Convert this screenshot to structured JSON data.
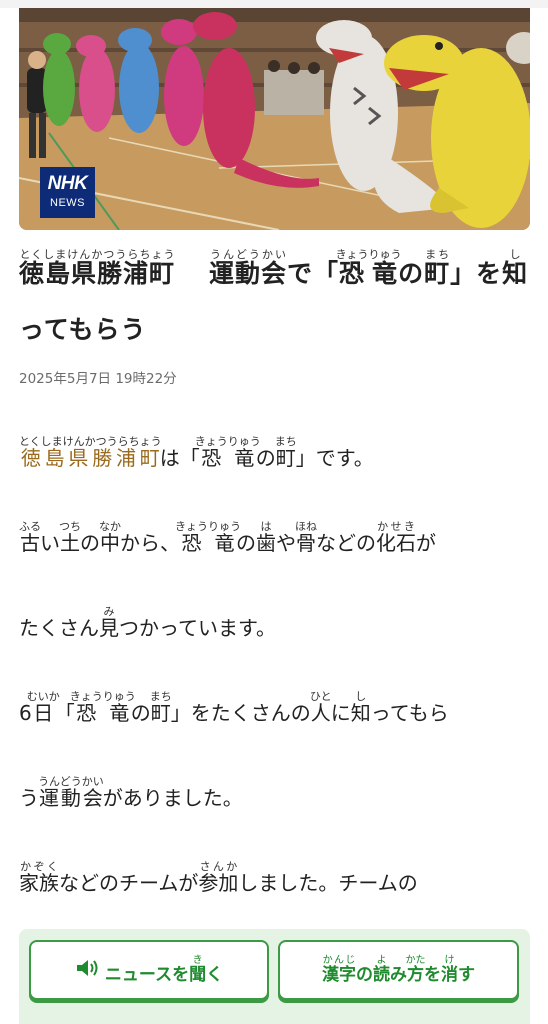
{
  "hero": {
    "badge_line1": "NHK",
    "badge_line2": "NEWS"
  },
  "article": {
    "title": {
      "part1": "徳島県勝浦町",
      "part1_ruby": "とくしまけんかつうらちょう",
      "part2": "運動会",
      "part2_ruby": "うんどうかい",
      "part3": "で「",
      "part4": "恐竜",
      "part4_ruby": "きょうりゅう",
      "part5": "の",
      "part6": "町",
      "part6_ruby": "まち",
      "part7": "」を",
      "part8": "知",
      "part8_ruby": "し",
      "part9": "ってもらう"
    },
    "date": "2025年5月7日 19時22分",
    "p1": {
      "place": "徳島県勝浦町",
      "place_ruby": "とくしまけんかつうらちょう",
      "t1": "は「",
      "k1": "恐竜",
      "k1_ruby": "きょうりゅう",
      "t2": "の",
      "k2": "町",
      "k2_ruby": "まち",
      "t3": "」です。"
    },
    "p2": {
      "k1": "古",
      "k1_ruby": "ふる",
      "t1": "い",
      "k2": "土",
      "k2_ruby": "つち",
      "t2": "の",
      "k3": "中",
      "k3_ruby": "なか",
      "t3": "から、",
      "k4": "恐竜",
      "k4_ruby": "きょうりゅう",
      "t4": "の",
      "k5": "歯",
      "k5_ruby": "は",
      "t5": "や",
      "k6": "骨",
      "k6_ruby": "ほね",
      "t6": "などの",
      "k7": "化石",
      "k7_ruby": "かせき",
      "t7": "が"
    },
    "p3": {
      "t1": "たくさん",
      "k1": "見",
      "k1_ruby": "み",
      "t2": "つかっています。"
    },
    "p4": {
      "t1": "6",
      "k1": "日",
      "k1_ruby": "むいか",
      "t2": "「",
      "k2": "恐竜",
      "k2_ruby": "きょうりゅう",
      "t3": "の",
      "k3": "町",
      "k3_ruby": "まち",
      "t4": "」をたくさんの",
      "k4": "人",
      "k4_ruby": "ひと",
      "t5": "に",
      "k5": "知",
      "k5_ruby": "し",
      "t6": "ってもら"
    },
    "p5": {
      "t1": "う",
      "k1": "運動会",
      "k1_ruby": "うんどうかい",
      "t2": "がありました。"
    },
    "p6": {
      "k1": "家族",
      "k1_ruby": "かぞく",
      "t1": "などのチームが",
      "k2": "参加",
      "k2_ruby": "さんか",
      "t2": "しました。チームの"
    }
  },
  "actions": {
    "listen_pre": "ニュースを",
    "listen_kanji": "聞",
    "listen_kanji_ruby": "き",
    "listen_post": "く",
    "kanji_k1": "漢字",
    "kanji_k1_ruby": "かんじ",
    "kanji_t1": "の",
    "kanji_k2": "読",
    "kanji_k2_ruby": "よ",
    "kanji_t2": "み",
    "kanji_k3": "方",
    "kanji_k3_ruby": "かた",
    "kanji_t3": "を",
    "kanji_k4": "消",
    "kanji_k4_ruby": "け",
    "kanji_t4": "す"
  },
  "colors": {
    "link_kanji": "#9a6b1f",
    "action_green": "#1f8a2e",
    "action_bg": "#e5f3e4",
    "nhk_badge": "#0e2b78"
  }
}
